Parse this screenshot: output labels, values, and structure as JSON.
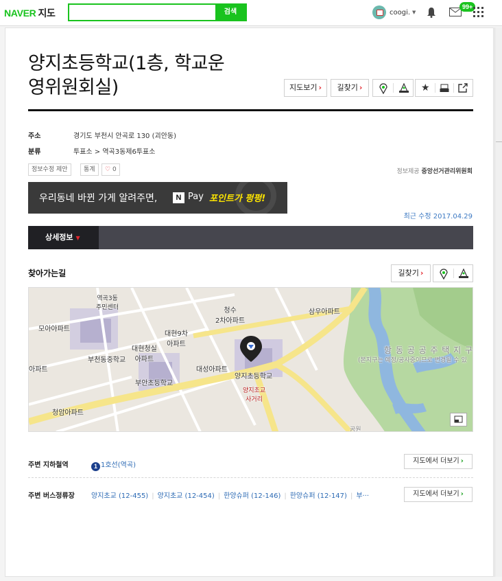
{
  "header": {
    "logo": "NAVER",
    "service": "지도",
    "search_value": "",
    "search_button": "검색",
    "user_name": "coogi.",
    "notification_badge": "99+",
    "icons": [
      "bell-icon",
      "mail-icon",
      "apps-grid-icon"
    ],
    "brand_color": "#19c31e"
  },
  "place": {
    "title_line1": "양지초등학교(1층, 학교운",
    "title_line2": "영위원회실)",
    "btn_map": "지도보기",
    "btn_route": "길찾기",
    "address_label": "주소",
    "address": "경기도 부천시 안곡로 130 (괴안동)",
    "category_label": "분류",
    "category": "투표소 > 역곡3동제6투표소",
    "btn_suggest": "정보수정 제안",
    "btn_stats": "통계",
    "like_count": "0",
    "provider_label": "정보제공",
    "provider": "중앙선거관리위원회",
    "banner_text": "우리동네 바뀐 가게 알려주면,",
    "banner_n": "N",
    "banner_pay": "Pay",
    "banner_highlight": "포인트가 펑펑!",
    "updated": "최근 수정 2017.04.29",
    "tab_detail": "상세정보"
  },
  "directions": {
    "heading": "찾아가는길",
    "btn_route": "길찾기",
    "map_labels": {
      "l1a": "역곡3동",
      "l1b": "주민센터",
      "l2": "모아아파트",
      "l3a": "청수",
      "l3b": "2차아파트",
      "l4": "삼우아파트",
      "l5a": "대현9차",
      "l5b": "아파트",
      "l6a": "대현청실",
      "l6b": "아파트",
      "l7": "부천동중학교",
      "l8": "대성아파트",
      "l9": "양지초등학교",
      "l10a": "양지초교",
      "l10b": "사거리",
      "l11": "부안초등학교",
      "l12": "청암아파트",
      "l13": "항 동 공 공 주 택 지 구",
      "l14": "(본지구는 예정/공사중이므로 변경될 수 있",
      "l15": "아파트",
      "l16": "공원"
    }
  },
  "nearby": {
    "subway_label": "주변 지하철역",
    "subway_line": "1",
    "subway_value": "1호선(역곡)",
    "bus_label": "주변 버스정류장",
    "bus_stops": [
      "양지초교 (12-455)",
      "양지초교 (12-454)",
      "한양슈퍼 (12-146)",
      "한양슈퍼 (12-147)",
      "부···"
    ],
    "more_label": "지도에서 더보기"
  }
}
